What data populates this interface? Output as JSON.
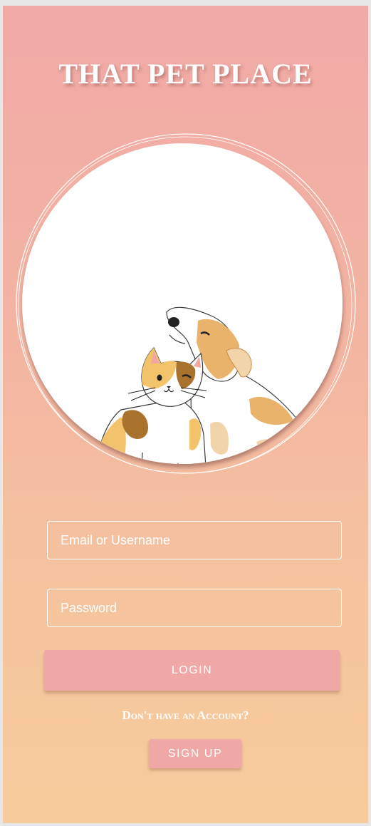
{
  "app": {
    "title": "THAT PET PLACE"
  },
  "form": {
    "email_placeholder": "Email or Username",
    "password_placeholder": "Password",
    "login_label": "LOGIN",
    "signup_prompt": "Don't have an Account?",
    "signup_label": "SIGN UP"
  },
  "hero": {
    "illustration": "cat-and-dog-illustration"
  },
  "colors": {
    "gradient_top": "#f1a9a6",
    "gradient_bottom": "#f6cc9c",
    "button": "#efa8a5",
    "text": "#ffffff"
  }
}
